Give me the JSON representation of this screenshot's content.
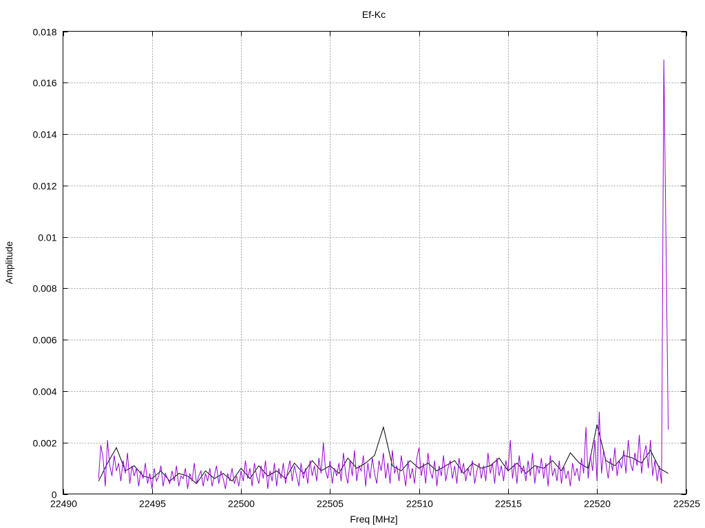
{
  "chart_data": {
    "type": "line",
    "title": "Ef-Kc",
    "xlabel": "Freq [MHz]",
    "ylabel": "Amplitude",
    "xlim": [
      22490,
      22525
    ],
    "ylim": [
      0,
      0.018
    ],
    "xticks": [
      22490,
      22495,
      22500,
      22505,
      22510,
      22515,
      22520,
      22525
    ],
    "xtick_labels": [
      "22490",
      "22495",
      "22500",
      "22505",
      "22510",
      "22515",
      "22520",
      "22525"
    ],
    "yticks": [
      0,
      0.002,
      0.004,
      0.006,
      0.008,
      0.01,
      0.012,
      0.014,
      0.016,
      0.018
    ],
    "ytick_labels": [
      "0",
      "0.002",
      "0.004",
      "0.006",
      "0.008",
      "0.01",
      "0.012",
      "0.014",
      "0.016",
      "0.018"
    ],
    "grid": true,
    "legend": "none",
    "series": [
      {
        "name": "series-black",
        "color": "#000000",
        "x_start": 22492,
        "x_step": 0.5,
        "values": [
          0.0005,
          0.0012,
          0.0018,
          0.0009,
          0.0011,
          0.0007,
          0.0006,
          0.0009,
          0.0005,
          0.0008,
          0.0007,
          0.0004,
          0.0009,
          0.0006,
          0.0008,
          0.0005,
          0.001,
          0.0006,
          0.0011,
          0.0007,
          0.0009,
          0.0006,
          0.0012,
          0.0008,
          0.0013,
          0.0009,
          0.0011,
          0.0008,
          0.0014,
          0.001,
          0.0012,
          0.0015,
          0.0026,
          0.0011,
          0.0009,
          0.0013,
          0.001,
          0.0012,
          0.0009,
          0.0011,
          0.0013,
          0.0008,
          0.0012,
          0.001,
          0.0011,
          0.0014,
          0.0009,
          0.0012,
          0.0008,
          0.0011,
          0.001,
          0.0013,
          0.0009,
          0.0016,
          0.0012,
          0.001,
          0.0027,
          0.0013,
          0.0011,
          0.0015,
          0.0014,
          0.0012,
          0.0017,
          0.001,
          0.0008
        ]
      },
      {
        "name": "series-purple",
        "color": "#9400d3",
        "x_start": 22492,
        "x_step": 0.125,
        "values": [
          0.0006,
          0.0019,
          0.0014,
          0.0003,
          0.0021,
          0.0011,
          0.0007,
          0.0015,
          0.0009,
          0.0012,
          0.0005,
          0.0013,
          0.0008,
          0.0016,
          0.0004,
          0.0011,
          0.0007,
          0.001,
          0.0003,
          0.0009,
          0.0006,
          0.0012,
          0.0004,
          0.0008,
          0.0002,
          0.001,
          0.0005,
          0.0007,
          0.0011,
          0.0003,
          0.0008,
          0.0006,
          0.0004,
          0.0009,
          0.0005,
          0.0011,
          0.0003,
          0.0007,
          0.0006,
          0.001,
          0.0002,
          0.0008,
          0.0005,
          0.0012,
          0.0004,
          0.0007,
          0.0009,
          0.0003,
          0.0008,
          0.0005,
          0.001,
          0.0003,
          0.0007,
          0.0011,
          0.0004,
          0.0009,
          0.0006,
          0.0002,
          0.0008,
          0.0005,
          0.001,
          0.0004,
          0.0007,
          0.0003,
          0.0009,
          0.0005,
          0.0013,
          0.0006,
          0.001,
          0.0003,
          0.0012,
          0.0007,
          0.0004,
          0.0011,
          0.0006,
          0.0013,
          0.0002,
          0.0009,
          0.0005,
          0.0012,
          0.0003,
          0.001,
          0.0006,
          0.0012,
          0.0004,
          0.0009,
          0.0013,
          0.0005,
          0.0011,
          0.0007,
          0.0003,
          0.0012,
          0.0006,
          0.001,
          0.0004,
          0.0013,
          0.0007,
          0.0011,
          0.0005,
          0.0014,
          0.0008,
          0.002,
          0.0009,
          0.0006,
          0.0013,
          0.0004,
          0.001,
          0.0007,
          0.0012,
          0.0005,
          0.0016,
          0.0008,
          0.0004,
          0.0013,
          0.0007,
          0.0017,
          0.0005,
          0.0011,
          0.0009,
          0.0015,
          0.0003,
          0.0012,
          0.0006,
          0.0014,
          0.0008,
          0.0004,
          0.0013,
          0.0009,
          0.0016,
          0.0006,
          0.0012,
          0.0004,
          0.0017,
          0.0008,
          0.0011,
          0.0005,
          0.0015,
          0.0009,
          0.0003,
          0.0013,
          0.0006,
          0.001,
          0.0004,
          0.0014,
          0.0018,
          0.0007,
          0.0012,
          0.0004,
          0.0016,
          0.0009,
          0.0006,
          0.0013,
          0.0003,
          0.0011,
          0.0007,
          0.0015,
          0.0005,
          0.001,
          0.0013,
          0.0006,
          0.0011,
          0.0004,
          0.0014,
          0.0008,
          0.0012,
          0.0005,
          0.001,
          0.0007,
          0.0013,
          0.0004,
          0.0009,
          0.0012,
          0.0006,
          0.0011,
          0.0005,
          0.0016,
          0.0008,
          0.0012,
          0.0004,
          0.0014,
          0.0007,
          0.0011,
          0.0005,
          0.0013,
          0.0009,
          0.0021,
          0.0006,
          0.0012,
          0.0004,
          0.0015,
          0.0008,
          0.0011,
          0.0005,
          0.0013,
          0.0007,
          0.0016,
          0.0004,
          0.0011,
          0.0008,
          0.0014,
          0.0006,
          0.0012,
          0.0003,
          0.0015,
          0.0007,
          0.001,
          0.0005,
          0.0013,
          0.0004,
          0.0011,
          0.0006,
          0.0009,
          0.0003,
          0.0012,
          0.0007,
          0.001,
          0.0005,
          0.0014,
          0.0008,
          0.0026,
          0.0006,
          0.0015,
          0.0009,
          0.0021,
          0.0005,
          0.0032,
          0.0008,
          0.0017,
          0.0012,
          0.0006,
          0.0014,
          0.0009,
          0.0018,
          0.0007,
          0.0013,
          0.001,
          0.0017,
          0.0008,
          0.0021,
          0.0012,
          0.0009,
          0.0016,
          0.0011,
          0.0023,
          0.0008,
          0.0015,
          0.0019,
          0.001,
          0.0021,
          0.0007,
          0.0013,
          0.0005,
          0.0011,
          0.0004,
          0.0169,
          0.0097,
          0.0025
        ]
      }
    ]
  }
}
